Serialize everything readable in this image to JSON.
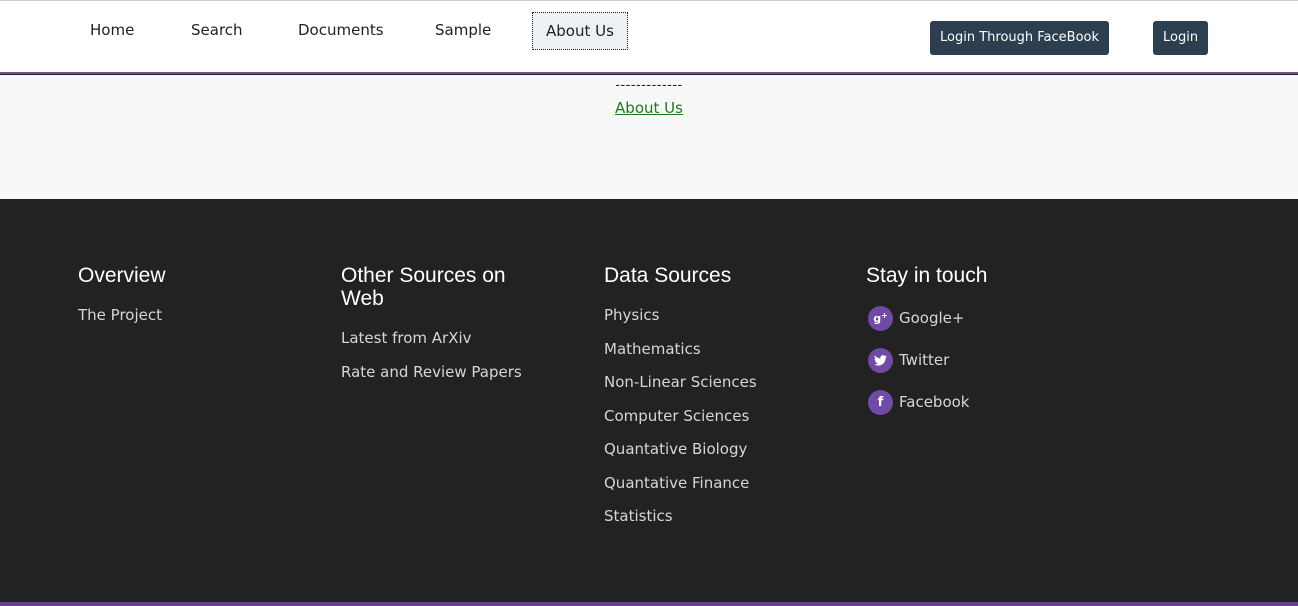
{
  "nav": {
    "items": [
      {
        "label": "Home"
      },
      {
        "label": "Search"
      },
      {
        "label": "Documents"
      },
      {
        "label": "Sample"
      },
      {
        "label": "About Us"
      }
    ],
    "facebook_login": "Login Through FaceBook",
    "login": "Login"
  },
  "breadcrumb": {
    "separator": "-------------",
    "current": "About Us"
  },
  "footer": {
    "overview": {
      "title": "Overview",
      "links": [
        "The Project"
      ]
    },
    "other_sources": {
      "title": "Other Sources on Web",
      "links": [
        "Latest from ArXiv",
        "Rate and Review Papers"
      ]
    },
    "data_sources": {
      "title": "Data Sources",
      "links": [
        "Physics",
        "Mathematics",
        "Non-Linear Sciences",
        "Computer Sciences",
        "Quantative Biology",
        "Quantative Finance",
        "Statistics"
      ]
    },
    "stay_in_touch": {
      "title": "Stay in touch",
      "links": [
        {
          "label": "Google+",
          "icon": "google-plus-icon"
        },
        {
          "label": "Twitter",
          "icon": "twitter-icon"
        },
        {
          "label": "Facebook",
          "icon": "facebook-icon"
        }
      ]
    }
  },
  "colors": {
    "accent_purple": "#6f4aa6",
    "nav_border": "#7a4a9b",
    "button_dark": "#2c3e50",
    "footer_bg": "#222222",
    "crumb_link": "#1e7a1e"
  }
}
